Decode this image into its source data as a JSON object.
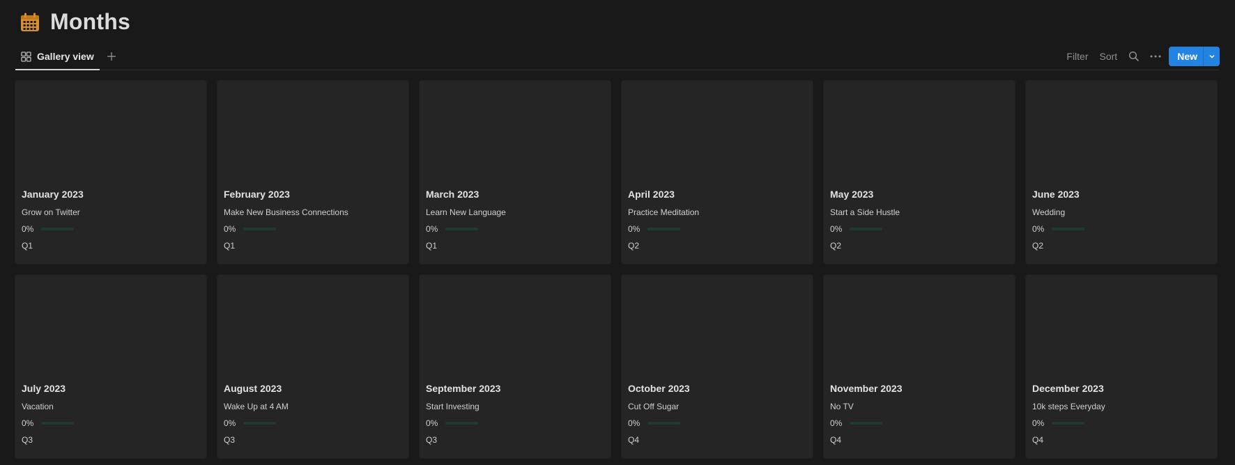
{
  "page": {
    "title": "Months",
    "icon": "calendar-icon",
    "icon_color": "#D9912B"
  },
  "toolbar": {
    "active_tab": "Gallery view",
    "filter_label": "Filter",
    "sort_label": "Sort",
    "new_label": "New",
    "accent": "#2383E2"
  },
  "cards": [
    {
      "title": "January 2023",
      "goal": "Grow on Twitter",
      "progress_label": "0%",
      "progress": 0,
      "quarter": "Q1"
    },
    {
      "title": "February 2023",
      "goal": "Make New Business Connections",
      "progress_label": "0%",
      "progress": 0,
      "quarter": "Q1"
    },
    {
      "title": "March 2023",
      "goal": "Learn New Language",
      "progress_label": "0%",
      "progress": 0,
      "quarter": "Q1"
    },
    {
      "title": "April 2023",
      "goal": "Practice Meditation",
      "progress_label": "0%",
      "progress": 0,
      "quarter": "Q2"
    },
    {
      "title": "May 2023",
      "goal": "Start a Side Hustle",
      "progress_label": "0%",
      "progress": 0,
      "quarter": "Q2"
    },
    {
      "title": "June 2023",
      "goal": "Wedding",
      "progress_label": "0%",
      "progress": 0,
      "quarter": "Q2"
    },
    {
      "title": "July 2023",
      "goal": "Vacation",
      "progress_label": "0%",
      "progress": 0,
      "quarter": "Q3"
    },
    {
      "title": "August 2023",
      "goal": "Wake Up at 4 AM",
      "progress_label": "0%",
      "progress": 0,
      "quarter": "Q3"
    },
    {
      "title": "September 2023",
      "goal": "Start Investing",
      "progress_label": "0%",
      "progress": 0,
      "quarter": "Q3"
    },
    {
      "title": "October 2023",
      "goal": "Cut Off Sugar",
      "progress_label": "0%",
      "progress": 0,
      "quarter": "Q4"
    },
    {
      "title": "November 2023",
      "goal": "No TV",
      "progress_label": "0%",
      "progress": 0,
      "quarter": "Q4"
    },
    {
      "title": "December 2023",
      "goal": "10k steps Everyday",
      "progress_label": "0%",
      "progress": 0,
      "quarter": "Q4"
    }
  ]
}
